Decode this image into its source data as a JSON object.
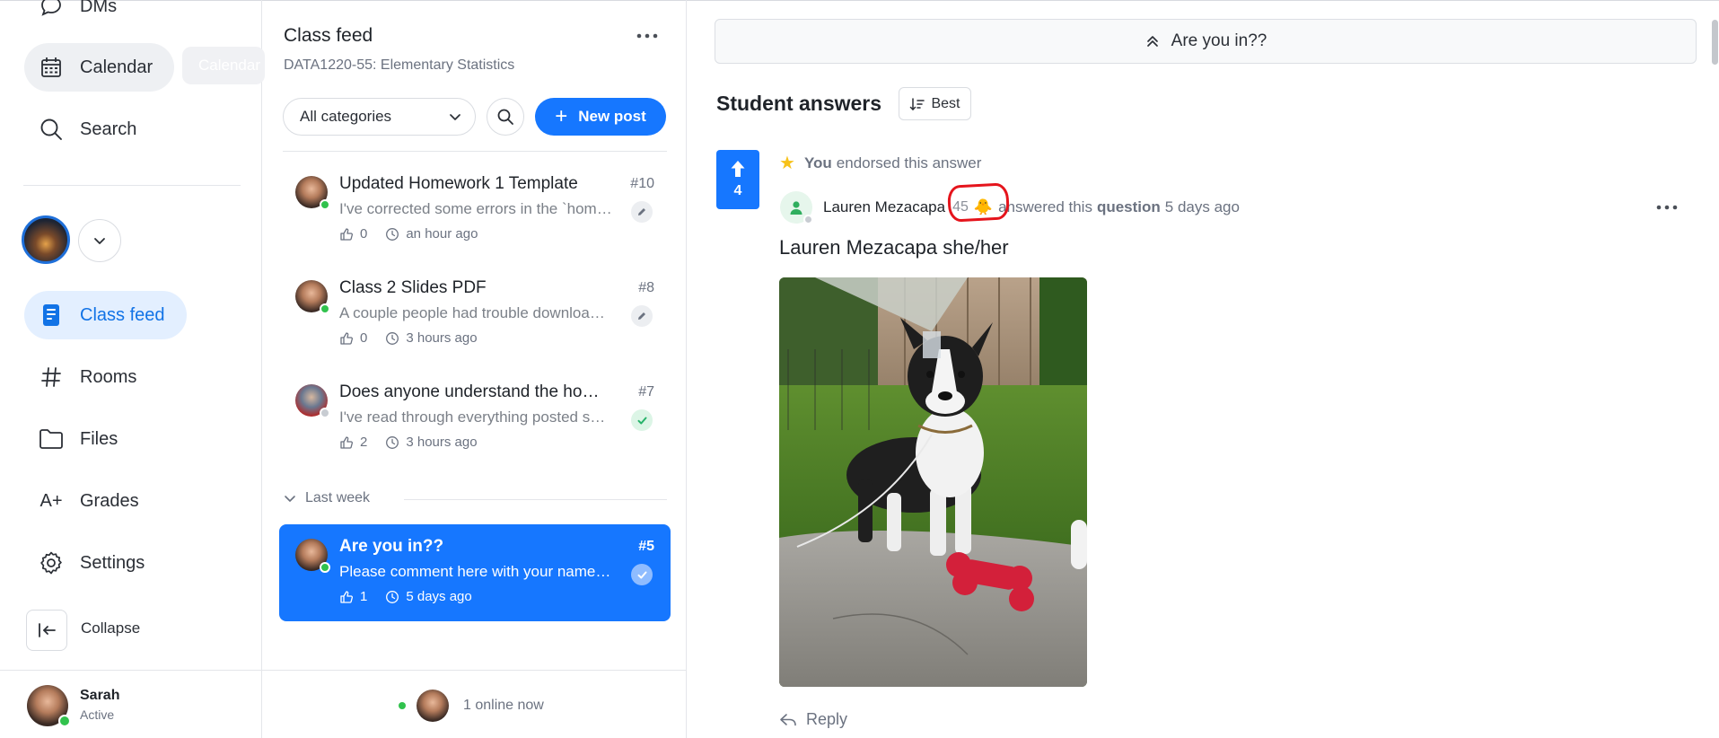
{
  "nav": {
    "dms_label": "DMs",
    "calendar_label": "Calendar",
    "calendar_tooltip": "Calendar",
    "search_label": "Search",
    "class_feed_label": "Class feed",
    "rooms_label": "Rooms",
    "files_label": "Files",
    "grades_label": "Grades",
    "settings_label": "Settings",
    "collapse_label": "Collapse",
    "grades_icon_text": "A+"
  },
  "user": {
    "name": "Sarah",
    "status": "Active"
  },
  "feed": {
    "title": "Class feed",
    "course": "DATA1220-55: Elementary Statistics",
    "category_select": "All categories",
    "new_post_label": "New post",
    "new_post_icon": "+",
    "posts": [
      {
        "title": "Updated Homework 1 Template",
        "number": "#10",
        "preview": "I've corrected some errors in the `homework template`",
        "likes": "0",
        "time": "an hour ago",
        "status_icon": "pencil-icon"
      },
      {
        "title": "Class 2 Slides PDF",
        "number": "#8",
        "preview": "A couple people had trouble downloading the slides",
        "likes": "0",
        "time": "3 hours ago",
        "status_icon": "pencil-icon"
      },
      {
        "title": "Does anyone understand the homework question?",
        "number": "#7",
        "preview": "I've read through everything posted so far",
        "likes": "2",
        "time": "3 hours ago",
        "status_icon": "check-icon"
      }
    ],
    "section_last_week": "Last week",
    "selected_post": {
      "title": "Are you in??",
      "number": "#5",
      "preview": "Please comment here with your name and pronouns",
      "likes": "1",
      "time": "5 days ago",
      "status_icon": "check-icon"
    },
    "online_now": "1 online now"
  },
  "main": {
    "question_title": "Are you in??",
    "answers_heading": "Student answers",
    "sort_label": "Best",
    "answer": {
      "votes": "4",
      "endorser": "You",
      "endorse_text": "endorsed this answer",
      "author": "Lauren Mezacapa",
      "score": "45",
      "badge_emoji": "🐥",
      "answered_text": "answered this",
      "question_word": "question",
      "time": "5 days ago",
      "body": "Lauren Mezacapa she/her",
      "reply_label": "Reply"
    }
  },
  "colors": {
    "accent": "#1677ff",
    "active_nav_bg": "#e3efff",
    "online": "#31c24d",
    "highlight_circle": "#e5141c",
    "star": "#f7c21a"
  }
}
